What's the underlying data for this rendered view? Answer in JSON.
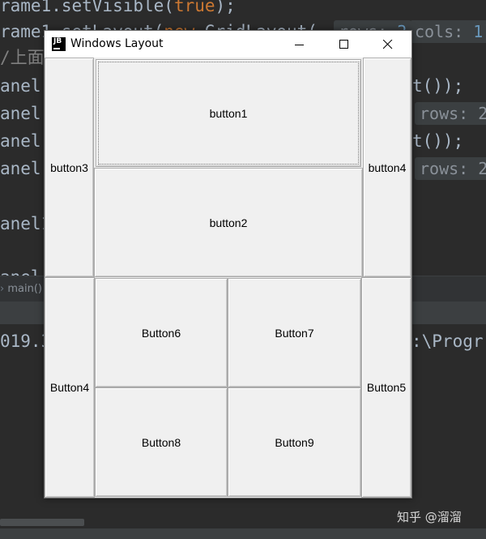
{
  "ide": {
    "lines": [
      {
        "text": "rame1.setVisible(",
        "kw": "true",
        "tail": ");"
      },
      {
        "text": "rame1.setLayout(",
        "kw": "new",
        "tail": " GridLayout("
      },
      {
        "text": "/上面",
        "kw": "",
        "tail": ""
      },
      {
        "text": "anel",
        "kw": "",
        "tail": ""
      },
      {
        "text": "anel",
        "kw": "",
        "tail": ""
      },
      {
        "text": "anel",
        "kw": "",
        "tail": ""
      },
      {
        "text": "anel",
        "kw": "",
        "tail": ""
      },
      {
        "text": "anel1",
        "kw": "",
        "tail": ""
      },
      {
        "text": "anel",
        "kw": "",
        "tail": ""
      }
    ],
    "hint_rows_label": "rows:",
    "hint_rows_value": "2",
    "hint_cols_label": "cols:",
    "hint_cols_value": "1",
    "hint_tail": ")",
    "code_right_1": "t());",
    "code_right_2": "rows: 2,",
    "code_right_3": "t());",
    "code_right_4": "rows: 2,",
    "breadcrumb": "main()",
    "console_left": "019.3",
    "console_right": ":\\Progr",
    "watermark": "知乎 @溜溜"
  },
  "window": {
    "title": "Windows Layout",
    "icon_text": "JB",
    "minimize_label": "minimize",
    "maximize_label": "maximize",
    "close_label": "close"
  },
  "buttons": {
    "top_left": "button3",
    "top_right": "button4",
    "top_center_1": "button1",
    "top_center_2": "button2",
    "bottom_left": "Button4",
    "bottom_right": "Button5",
    "grid_1": "Button6",
    "grid_2": "Button7",
    "grid_3": "Button8",
    "grid_4": "Button9"
  }
}
